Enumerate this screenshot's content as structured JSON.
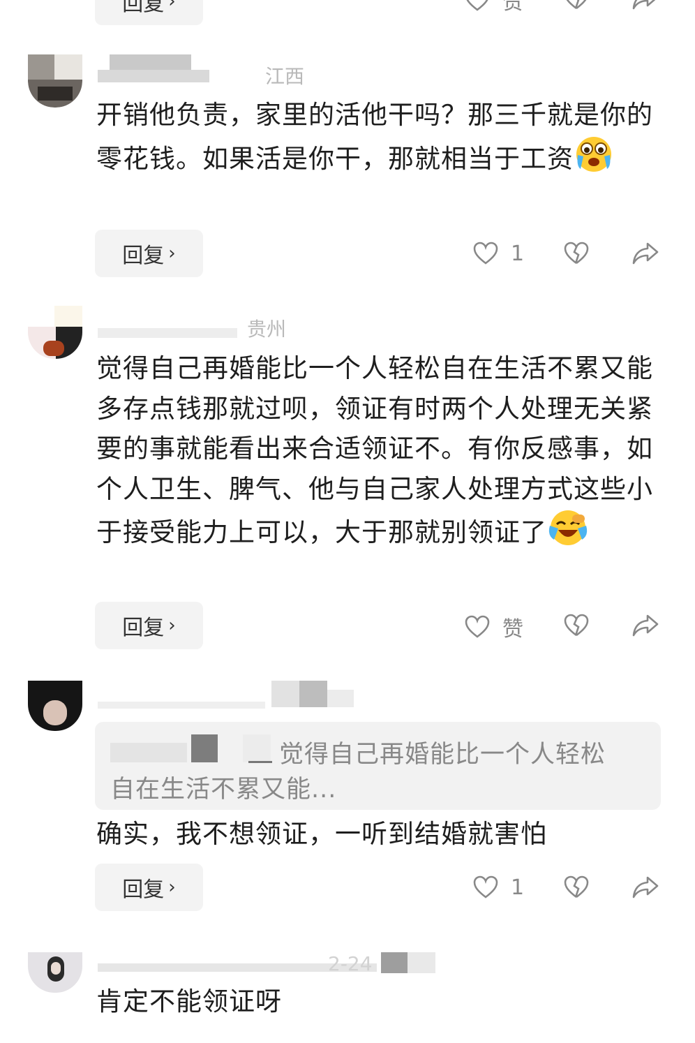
{
  "comments": [
    {
      "meta": "江西",
      "text": "开销他负责，家里的活他干吗？那三千就是你的零花钱。如果活是你干，那就相当于工资",
      "emoji": "crying-face-emoji",
      "reply_label": "回复",
      "like_count": "1",
      "like_label": ""
    },
    {
      "meta": "贵州",
      "text": "觉得自己再婚能比一个人轻松自在生活不累又能多存点钱那就过呗，领证有时两个人处理无关紧要的事就能看出来合适领证不。有你反感事，如个人卫生、脾气、他与自己家人处理方式这些小于接受能力上可以，大于那就别领证了",
      "emoji": "laughing-crying-face-emoji",
      "reply_label": "回复",
      "like_count": "",
      "like_label": "赞"
    },
    {
      "meta": "",
      "quote_text_line1": "觉得自己再婚能比一个人轻松",
      "quote_text_line2": "自在生活不累又能...",
      "text": "确实，我不想领证，一听到结婚就害怕",
      "reply_label": "回复",
      "like_count": "1",
      "like_label": ""
    },
    {
      "meta": "2-24",
      "text": "肯定不能领证呀"
    }
  ],
  "top_partial": {
    "reply_label": "回复",
    "like_label": "赞"
  },
  "colors": {
    "text": "#1e1e1e",
    "muted": "#888888",
    "button_bg": "#f3f3f3"
  }
}
